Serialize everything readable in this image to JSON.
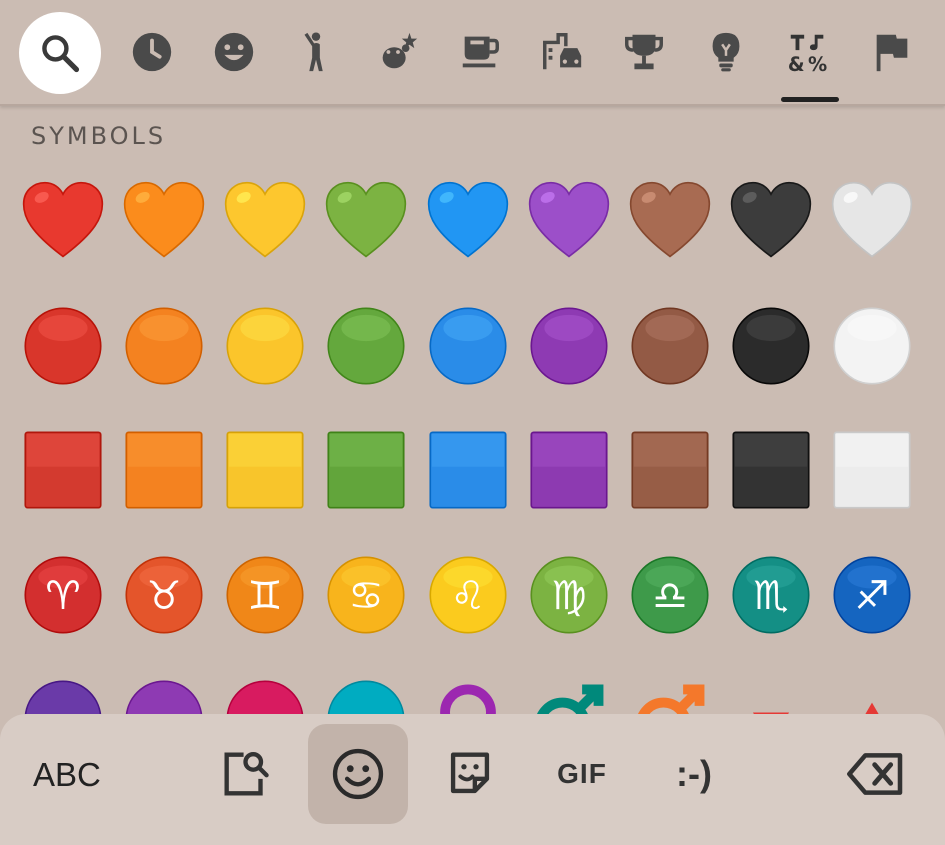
{
  "category_bar": {
    "items": [
      {
        "name": "search-icon"
      },
      {
        "name": "recent-clock-icon"
      },
      {
        "name": "smiley-icon"
      },
      {
        "name": "person-icon"
      },
      {
        "name": "nature-icon"
      },
      {
        "name": "food-cup-icon"
      },
      {
        "name": "travel-places-icon"
      },
      {
        "name": "trophy-activities-icon"
      },
      {
        "name": "lightbulb-objects-icon"
      },
      {
        "name": "symbols-icon"
      },
      {
        "name": "flag-icon"
      }
    ],
    "selected": "symbols-icon"
  },
  "section": {
    "title": "SYMBOLS"
  },
  "emoji_rows": [
    {
      "shape": "heart",
      "colors": [
        "#e8392f",
        "#fb8c1c",
        "#fdc72e",
        "#7cb342",
        "#2196f3",
        "#9c4fc9",
        "#a86b52",
        "#3c3c3c",
        "#e6e6e6"
      ]
    },
    {
      "shape": "circle",
      "colors": [
        "#d9362b",
        "#f48220",
        "#fbc52b",
        "#64a83d",
        "#2a8ce8",
        "#8e3ab3",
        "#935a45",
        "#2b2b2b",
        "#f3f3f3"
      ]
    },
    {
      "shape": "square",
      "colors": [
        "#d33a2f",
        "#f48220",
        "#f8c52b",
        "#62a53b",
        "#2a8ce8",
        "#8d3ab1",
        "#975d46",
        "#333333",
        "#ececec"
      ]
    },
    {
      "shape": "zodiac",
      "colors": [
        "#d32f2f",
        "#e4552b",
        "#f08718",
        "#f8b41c",
        "#fbcb1e",
        "#7cb342",
        "#3e9a4a",
        "#148f85",
        "#1565c0"
      ],
      "glyphs": [
        "♈",
        "♉",
        "♊",
        "♋",
        "♌",
        "♍",
        "♎",
        "♏",
        "♐"
      ]
    },
    {
      "shape": "partial",
      "colors": [
        "#6a3aa8",
        "#8e3ab3",
        "#d81b60",
        "#00acc1",
        "#9c27b0",
        "#00897b",
        "#f4782b",
        "#e53935",
        "#e53935"
      ]
    }
  ],
  "bottom_bar": {
    "abc_label": "ABC",
    "gif_label": "GIF",
    "emoticon_label": ":-)",
    "icons": [
      "clipboard-search-icon",
      "emoji-smiley-icon",
      "sticker-icon",
      "gif-icon",
      "emoticon-icon",
      "backspace-icon"
    ],
    "active": "emoji-smiley-icon"
  }
}
